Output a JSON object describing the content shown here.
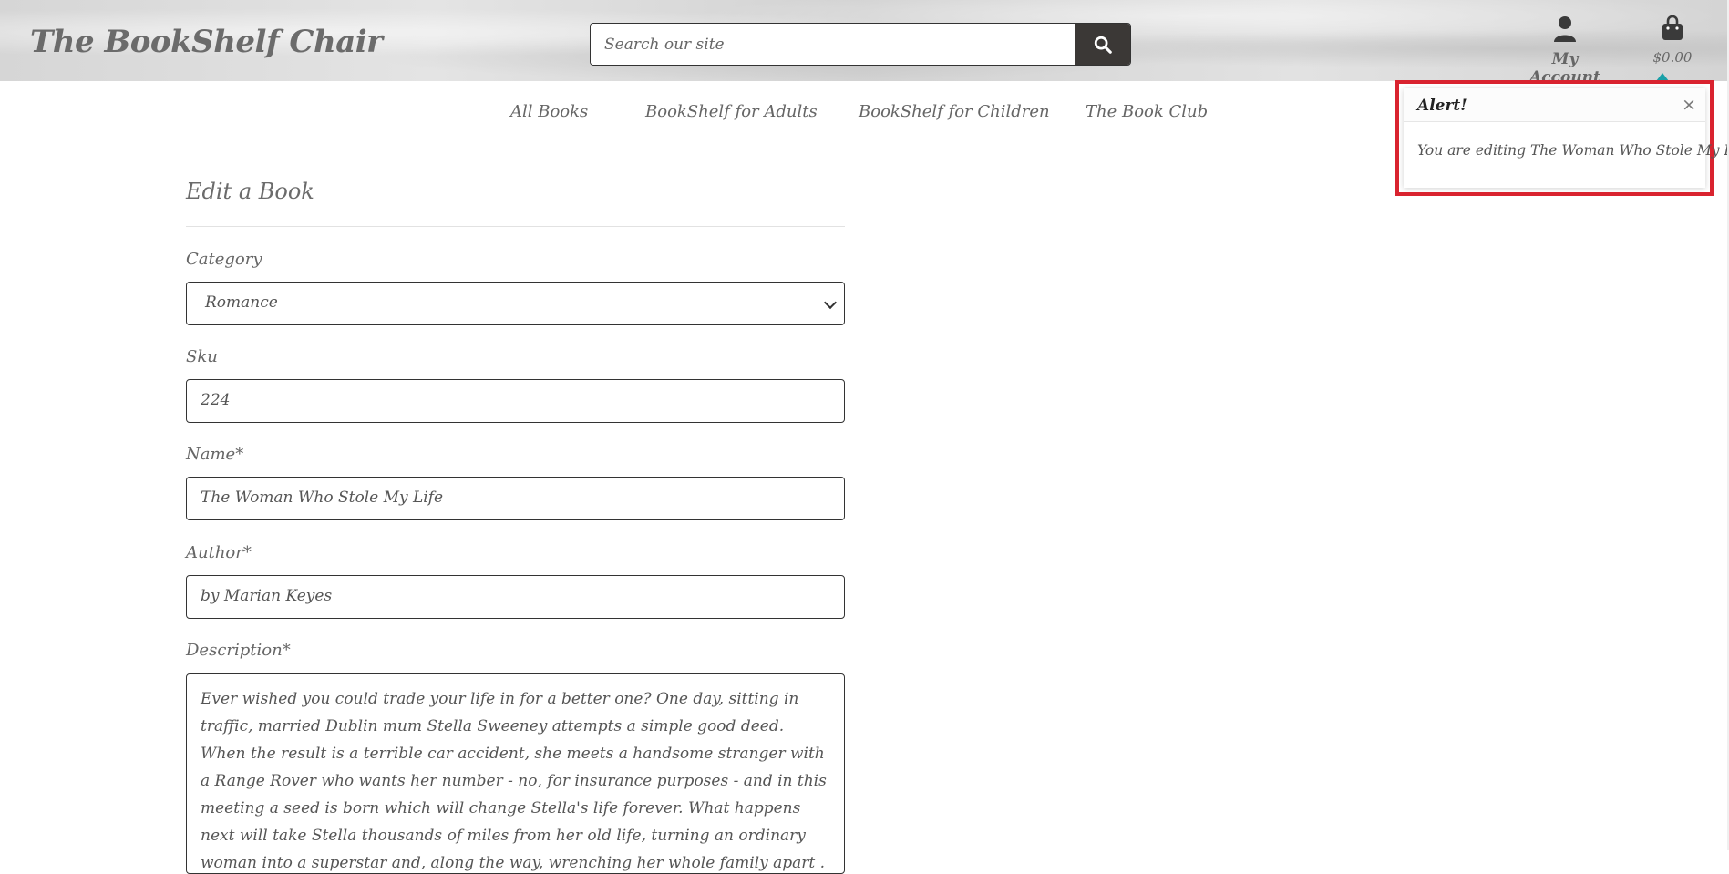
{
  "header": {
    "brand": "The BookShelf Chair",
    "search_placeholder": "Search our site",
    "account_label": "My Account",
    "bag_total": "$0.00"
  },
  "nav": {
    "items": [
      "All Books",
      "BookShelf for Adults",
      "BookShelf for Children",
      "The Book Club"
    ]
  },
  "toast": {
    "title": "Alert!",
    "close": "×",
    "message": "You are editing The Woman Who Stole My Life"
  },
  "form": {
    "title": "Edit a Book",
    "category_label": "Category",
    "category_value": "Romance",
    "sku_label": "Sku",
    "sku_value": "224",
    "name_label": "Name*",
    "name_value": "The Woman Who Stole My Life",
    "author_label": "Author*",
    "author_value": "by Marian Keyes",
    "description_label": "Description*",
    "description_value": "Ever wished you could trade your life in for a better one? One day, sitting in traffic, married Dublin mum Stella Sweeney attempts a simple good deed. When the result is a terrible car accident, she meets a handsome stranger with a Range Rover who wants her number - no, for insurance purposes - and in this meeting a seed is born which will change Stella's life forever. What happens next will take Stella thousands of miles from her old life, turning an ordinary woman into a superstar and, along the way, wrenching her whole family apart . . ."
  },
  "colors": {
    "accent_teal": "#1aa0a8",
    "highlight_red": "#d9232f",
    "search_button": "#3b3836"
  }
}
